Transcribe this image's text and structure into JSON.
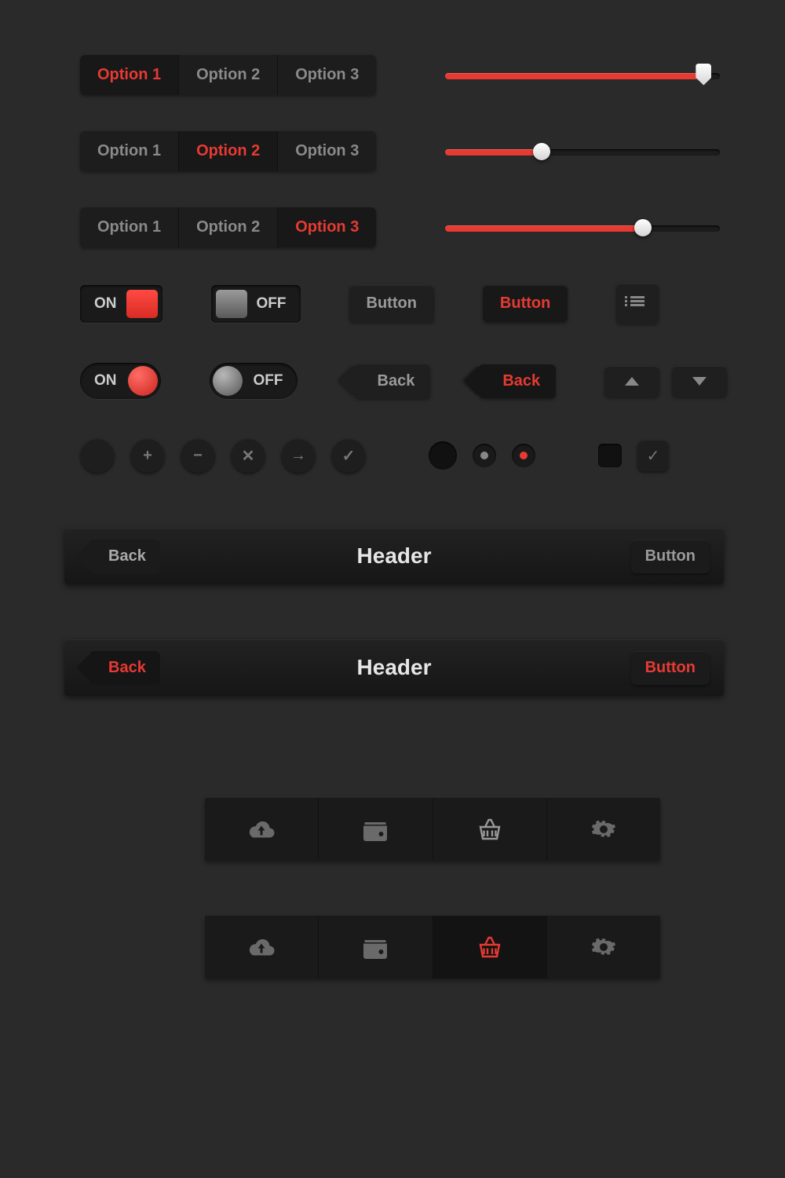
{
  "segments": {
    "opts": [
      "Option 1",
      "Option 2",
      "Option 3"
    ]
  },
  "sliders": [
    {
      "pct": 94,
      "thumb": "tag"
    },
    {
      "pct": 35,
      "thumb": "round"
    },
    {
      "pct": 72,
      "thumb": "round"
    }
  ],
  "toggles": {
    "on": "ON",
    "off": "OFF"
  },
  "buttons": {
    "plain": "Button",
    "red": "Button",
    "back": "Back"
  },
  "headers": [
    {
      "back": "Back",
      "title": "Header",
      "action": "Button",
      "style": "grey"
    },
    {
      "back": "Back",
      "title": "Header",
      "action": "Button",
      "style": "red"
    }
  ],
  "tabs": [
    "cloud",
    "wallet",
    "basket",
    "gear"
  ],
  "icons": {
    "plus": "+",
    "minus": "−",
    "times": "✕",
    "arrow": "→",
    "check": "✓"
  },
  "colors": {
    "accent": "#e73a33",
    "bg": "#2a2a2a",
    "panel": "#1d1d1d"
  }
}
